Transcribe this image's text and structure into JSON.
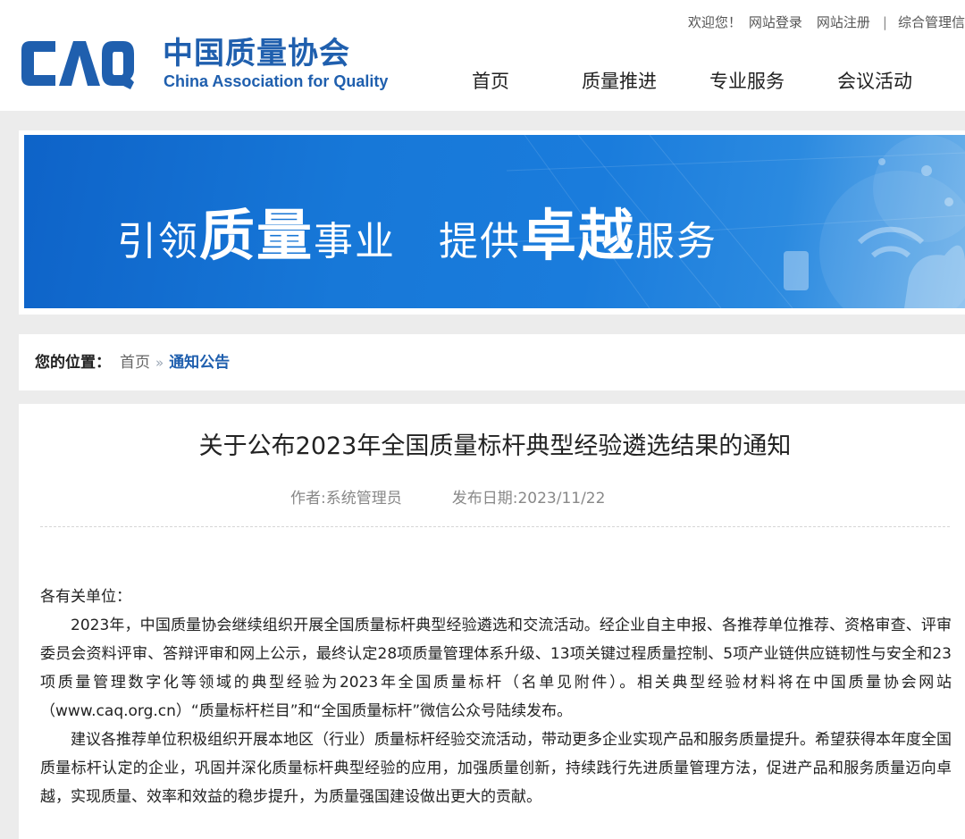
{
  "header": {
    "logo": {
      "mark": "CAQ",
      "name_cn": "中国质量协会",
      "name_en": "China Association for Quality",
      "color": "#1f5fae"
    },
    "top_links": {
      "welcome": "欢迎您！",
      "login": "网站登录",
      "register": "网站注册",
      "separator": "|",
      "admin": "综合管理信"
    },
    "nav": [
      "首页",
      "质量推进",
      "专业服务",
      "会议活动"
    ]
  },
  "banner": {
    "slogan_parts": [
      "引领",
      "质量",
      "事业",
      "提供",
      "卓越",
      "服务"
    ]
  },
  "breadcrumb": {
    "label": "您的位置：",
    "home": "首页",
    "arrows": "»",
    "current": "通知公告"
  },
  "article": {
    "title": "关于公布2023年全国质量标杆典型经验遴选结果的通知",
    "author": "作者:系统管理员",
    "date": "发布日期:2023/11/22",
    "salutation": "各有关单位：",
    "paragraphs": [
      "2023年，中国质量协会继续组织开展全国质量标杆典型经验遴选和交流活动。经企业自主申报、各推荐单位推荐、资格审查、评审委员会资料评审、答辩评审和网上公示，最终认定28项质量管理体系升级、13项关键过程质量控制、5项产业链供应链韧性与安全和23项质量管理数字化等领域的典型经验为2023年全国质量标杆（名单见附件）。相关典型经验材料将在中国质量协会网站（www.caq.org.cn）“质量标杆栏目”和“全国质量标杆”微信公众号陆续发布。",
      "建议各推荐单位积极组织开展本地区（行业）质量标杆经验交流活动，带动更多企业实现产品和服务质量提升。希望获得本年度全国质量标杆认定的企业，巩固并深化质量标杆典型经验的应用，加强质量创新，持续践行先进质量管理方法，促进产品和服务质量迈向卓越，实现质量、效率和效益的稳步提升，为质量强国建设做出更大的贡献。"
    ]
  },
  "colors": {
    "brand": "#1f5fae",
    "banner_blue": "#1778d8",
    "page_bg": "#ececec"
  }
}
